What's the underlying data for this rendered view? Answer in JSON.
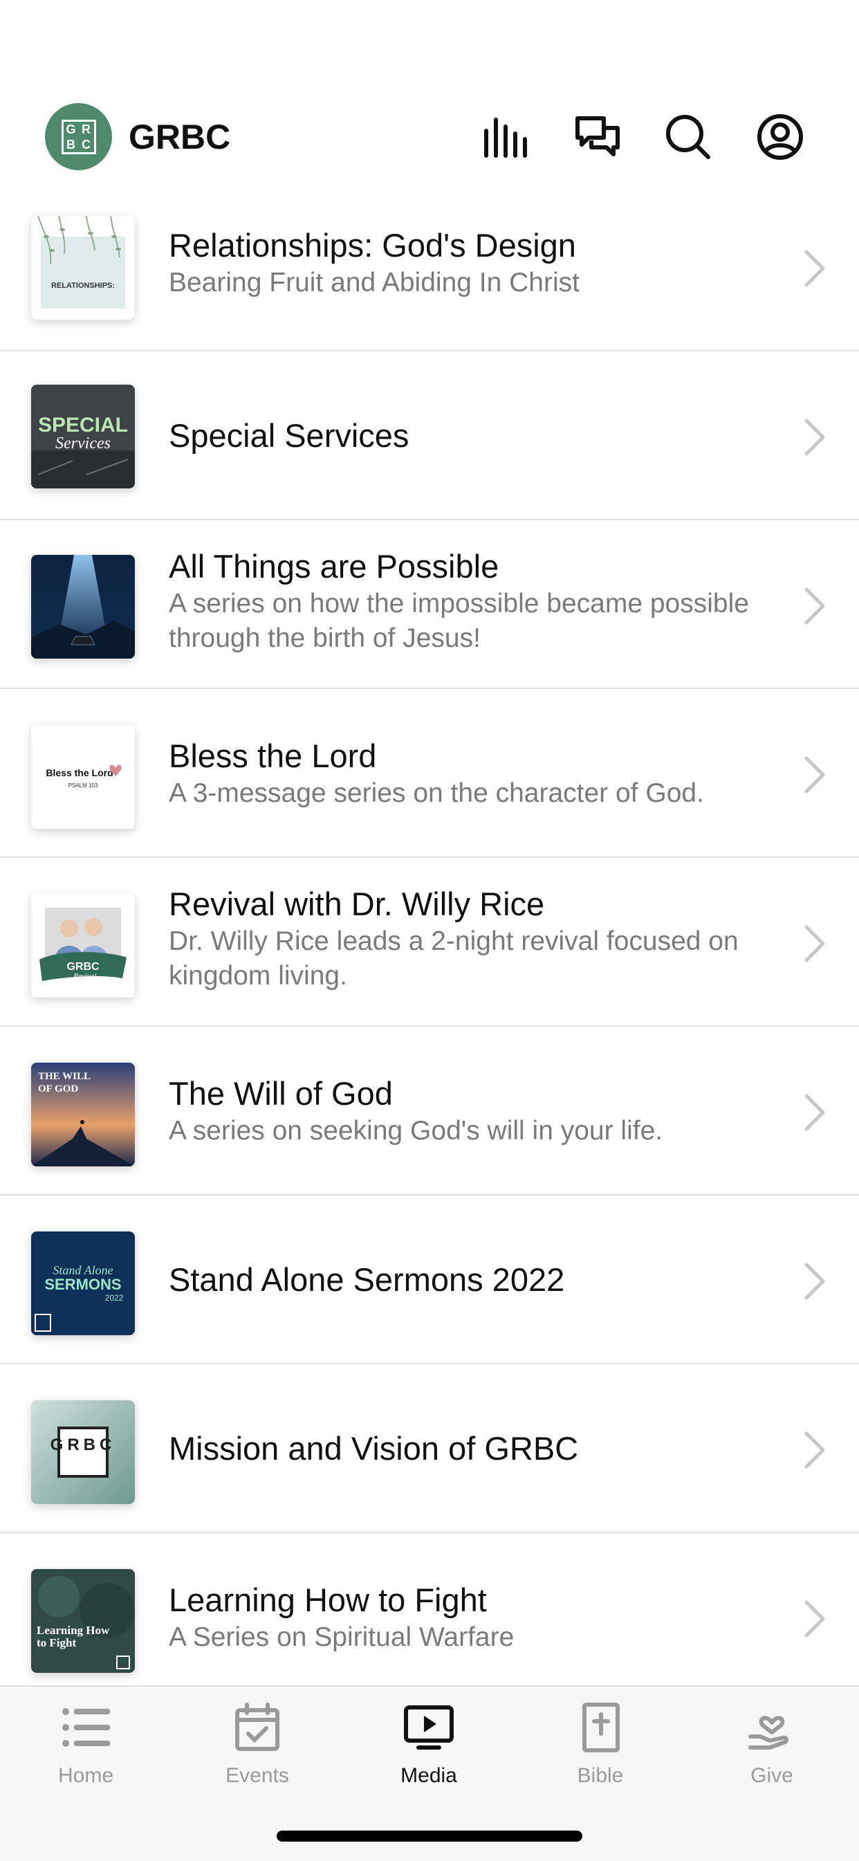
{
  "app": {
    "name": "GRBC",
    "logo_letters": [
      "G",
      "R",
      "B",
      "C"
    ],
    "accent": "#4e8a6b"
  },
  "header_icons": [
    "audio-bars-icon",
    "chat-bubbles-icon",
    "search-icon",
    "profile-icon"
  ],
  "series": [
    {
      "title": "Relationships: God's Design",
      "subtitle": "Bearing Fruit and Abiding In Christ",
      "thumb": "relationships-thumbnail",
      "thumb_text": "RELATIONSHIPS:"
    },
    {
      "title": "Special Services",
      "subtitle": "",
      "thumb": "special-services-thumbnail",
      "thumb_text": "SPECIAL",
      "thumb_text2": "Services"
    },
    {
      "title": "All Things are Possible",
      "subtitle": "A series on how the impossible became possible through the birth of Jesus!",
      "thumb": "manger-thumbnail"
    },
    {
      "title": "Bless the Lord",
      "subtitle": "A 3-message series on the character of God.",
      "thumb": "bless-the-lord-thumbnail",
      "thumb_text": "Bless the Lord",
      "thumb_text2": "PSALM 103"
    },
    {
      "title": "Revival with Dr. Willy Rice",
      "subtitle": "Dr. Willy Rice leads a 2-night revival focused on kingdom living.",
      "thumb": "revival-thumbnail",
      "thumb_text": "GRBC",
      "thumb_text2": "Revival"
    },
    {
      "title": "The Will of God",
      "subtitle": "A series on seeking God's will in your life.",
      "thumb": "will-of-god-thumbnail",
      "thumb_text": "THE WILL",
      "thumb_text2": "OF GOD"
    },
    {
      "title": "Stand Alone Sermons 2022",
      "subtitle": "",
      "thumb": "stand-alone-thumbnail",
      "thumb_text": "Stand Alone",
      "thumb_text2": "SERMONS",
      "thumb_text3": "2022"
    },
    {
      "title": "Mission and Vision of GRBC",
      "subtitle": "",
      "thumb": "mission-vision-thumbnail",
      "thumb_text": "GRBC"
    },
    {
      "title": "Learning How to Fight",
      "subtitle": "A Series on Spiritual Warfare",
      "thumb": "learning-fight-thumbnail",
      "thumb_text": "Learning How",
      "thumb_text2": "to Fight"
    }
  ],
  "tabs": [
    {
      "label": "Home",
      "icon": "list-icon",
      "active": false
    },
    {
      "label": "Events",
      "icon": "calendar-check-icon",
      "active": false
    },
    {
      "label": "Media",
      "icon": "play-screen-icon",
      "active": true
    },
    {
      "label": "Bible",
      "icon": "bible-icon",
      "active": false
    },
    {
      "label": "Give",
      "icon": "heart-hand-icon",
      "active": false
    }
  ],
  "colors": {
    "active_tab": "#111111",
    "inactive_tab": "#9a9a9a",
    "subtitle": "#7a7a7a",
    "chevron": "#c7c7cc"
  }
}
